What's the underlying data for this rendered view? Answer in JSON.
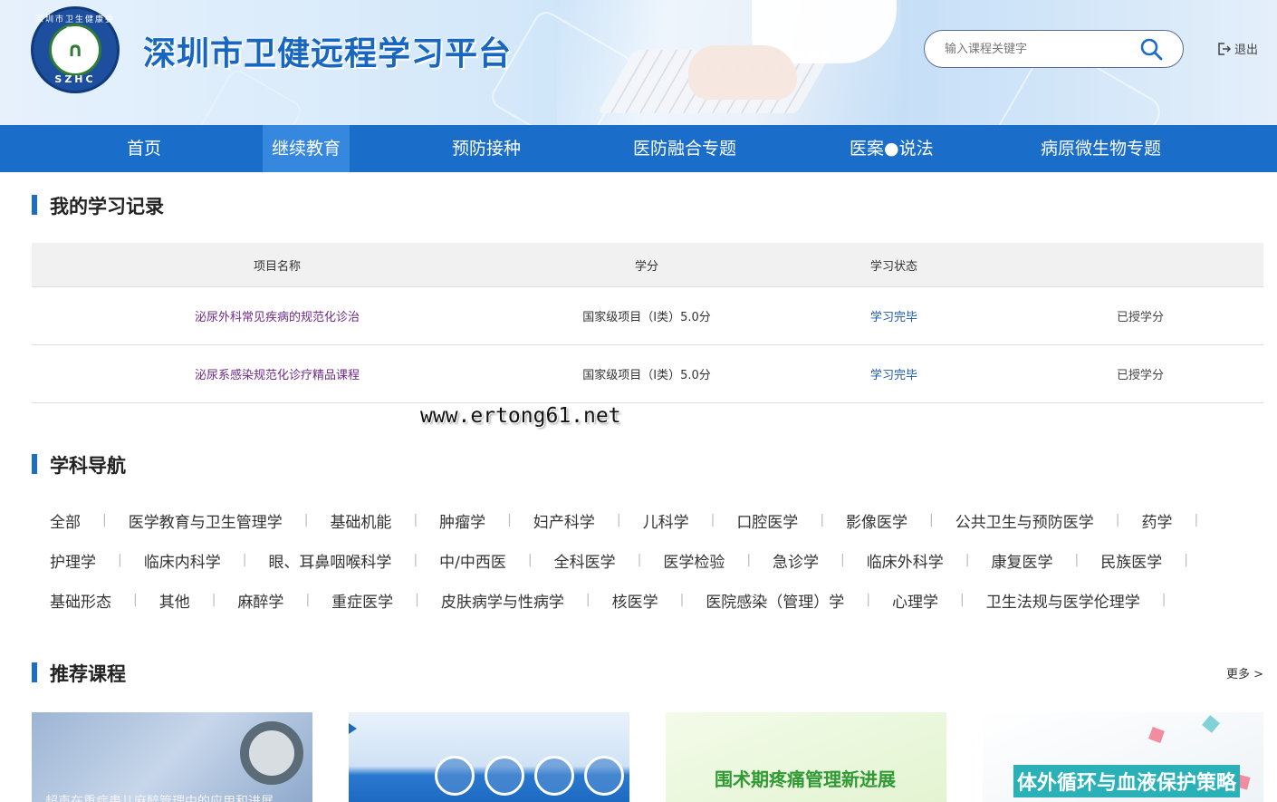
{
  "header": {
    "logo_bottom": "SZHC",
    "logo_ring": "深圳市卫生健康委员会",
    "title": "深圳市卫健远程学习平台",
    "search_placeholder": "输入课程关键字",
    "logout": "退出"
  },
  "nav": {
    "items": [
      {
        "label": "首页",
        "active": false
      },
      {
        "label": "继续教育",
        "active": true
      },
      {
        "label": "预防接种",
        "active": false
      },
      {
        "label": "医防融合专题",
        "active": false
      },
      {
        "label": "医案●说法",
        "active": false
      },
      {
        "label": "病原微生物专题",
        "active": false
      }
    ]
  },
  "records": {
    "title": "我的学习记录",
    "columns": [
      "项目名称",
      "学分",
      "学习状态",
      ""
    ],
    "rows": [
      {
        "name": "泌尿外科常见疾病的规范化诊治",
        "credit": "国家级项目（I类）5.0分",
        "status": "学习完毕",
        "grant": "已授学分"
      },
      {
        "name": "泌尿系感染规范化诊疗精品课程",
        "credit": "国家级项目（I类）5.0分",
        "status": "学习完毕",
        "grant": "已授学分"
      }
    ]
  },
  "watermark": "www.ertong61.net",
  "subjects": {
    "title": "学科导航",
    "rows": [
      [
        "全部",
        "医学教育与卫生管理学",
        "基础机能",
        "肿瘤学",
        "妇产科学",
        "儿科学",
        "口腔医学",
        "影像医学",
        "公共卫生与预防医学",
        "药学"
      ],
      [
        "护理学",
        "临床内科学",
        "眼、耳鼻咽喉科学",
        "中/中西医",
        "全科医学",
        "医学检验",
        "急诊学",
        "临床外科学",
        "康复医学",
        "民族医学"
      ],
      [
        "基础形态",
        "其他",
        "麻醉学",
        "重症医学",
        "皮肤病学与性病学",
        "核医学",
        "医院感染（管理）学",
        "心理学",
        "卫生法规与医学伦理学"
      ]
    ]
  },
  "recommended": {
    "title": "推荐课程",
    "more": "更多 >",
    "cards": [
      {
        "caption": "超声在重症患儿麻醉管理中的应用和进展"
      },
      {
        "caption": ""
      },
      {
        "caption": "围术期疼痛管理新进展"
      },
      {
        "caption": "体外循环与血液保护策略"
      }
    ]
  },
  "colors": {
    "brand": "#1a6dc9",
    "nav_active": "#3688de",
    "link": "#6e2b86",
    "status": "#1c5aa8"
  }
}
